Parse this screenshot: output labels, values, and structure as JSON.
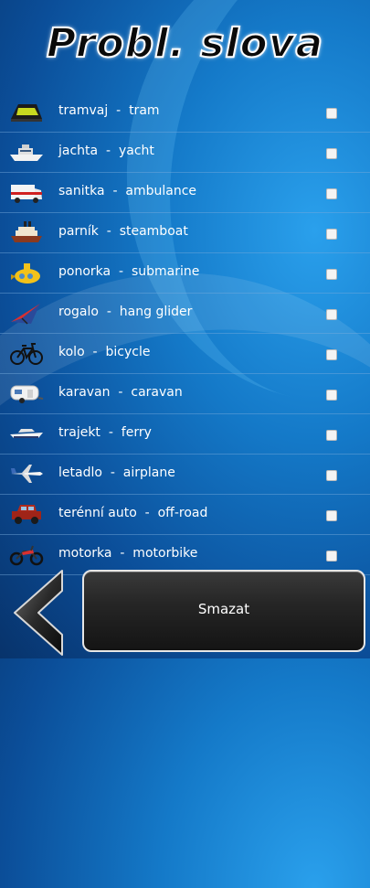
{
  "title": "Probl. slova",
  "items": [
    {
      "label": "tramvaj  -  tram",
      "icon": "tram-icon"
    },
    {
      "label": "jachta  -  yacht",
      "icon": "yacht-icon"
    },
    {
      "label": "sanitka  -  ambulance",
      "icon": "ambulance-icon"
    },
    {
      "label": "parník  -  steamboat",
      "icon": "steamboat-icon"
    },
    {
      "label": "ponorka  -  submarine",
      "icon": "submarine-icon"
    },
    {
      "label": "rogalo  -  hang glider",
      "icon": "hang-glider-icon"
    },
    {
      "label": "kolo  -  bicycle",
      "icon": "bicycle-icon"
    },
    {
      "label": "karavan  -  caravan",
      "icon": "caravan-icon"
    },
    {
      "label": "trajekt  -  ferry",
      "icon": "ferry-icon"
    },
    {
      "label": "letadlo  -  airplane",
      "icon": "airplane-icon"
    },
    {
      "label": "terénní auto  -  off-road",
      "icon": "off-road-car-icon"
    },
    {
      "label": "motorka  -  motorbike",
      "icon": "motorbike-icon"
    }
  ],
  "delete_button": "Smazat",
  "back_icon": "back-arrow-icon",
  "colors": {
    "background": "#1479c8",
    "button": "#1e1e1e",
    "text": "#ffffff"
  }
}
